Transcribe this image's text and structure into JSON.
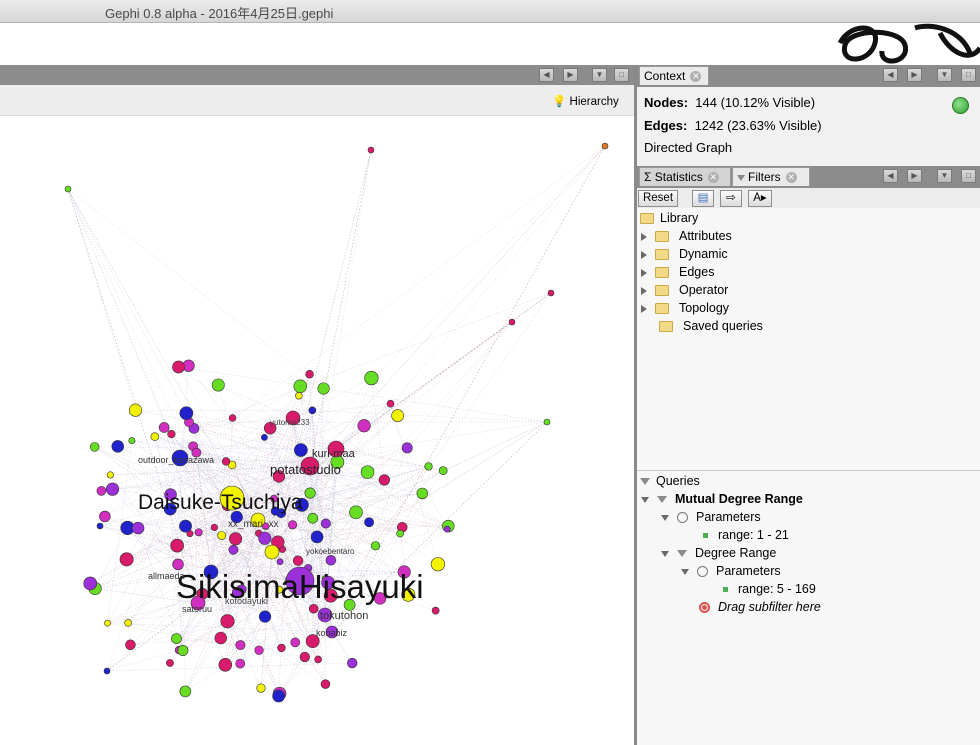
{
  "window": {
    "title": "Gephi 0.8 alpha  - 2016年4月25日.gephi"
  },
  "graph": {
    "toolbar": {
      "hierarchy_label": "Hierarchy"
    },
    "labels": [
      {
        "text": "SikisimaHisayuki",
        "size": "big"
      },
      {
        "text": "Daisuke-Tsuchiya",
        "size": "medium"
      },
      {
        "text": "potatostudio",
        "size": "small"
      },
      {
        "text": "kuri-maa",
        "size": "small"
      },
      {
        "text": "outdoor_kanazawa",
        "size": "tiny"
      },
      {
        "text": "xx_mari_xx",
        "size": "tiny"
      },
      {
        "text": "yokoebentaro",
        "size": "tiny"
      },
      {
        "text": "allmaeda",
        "size": "tiny"
      },
      {
        "text": "satoruu",
        "size": "tiny"
      },
      {
        "text": "tokutohon",
        "size": "tiny"
      },
      {
        "text": "kobabiz",
        "size": "tiny"
      },
      {
        "text": "yutoma233",
        "size": "tiny"
      },
      {
        "text": "kotodayuki",
        "size": "tiny"
      }
    ]
  },
  "context": {
    "tab_label": "Context",
    "nodes_label": "Nodes:",
    "nodes_value": "144 (10.12% Visible)",
    "edges_label": "Edges:",
    "edges_value": "1242 (23.63% Visible)",
    "graph_type": "Directed Graph"
  },
  "filters_panel": {
    "tabs": [
      {
        "label": "Statistics",
        "icon": "sigma-icon"
      },
      {
        "label": "Filters",
        "icon": "filter-icon"
      }
    ],
    "reset_label": "Reset",
    "library_label": "Library",
    "library_items": [
      "Attributes",
      "Dynamic",
      "Edges",
      "Operator",
      "Topology"
    ],
    "saved_queries_label": "Saved queries",
    "queries": {
      "label": "Queries",
      "root": "Mutual Degree Range",
      "root_params_label": "Parameters",
      "root_range": "range: 1 - 21",
      "sub": "Degree Range",
      "sub_params_label": "Parameters",
      "sub_range": "range: 5 - 169",
      "drag_hint": "Drag subfilter here"
    }
  },
  "colors": {
    "pink": "#d81b6b",
    "magenta": "#d12fbf",
    "purple": "#9b30d9",
    "blue": "#2222cc",
    "yellow": "#f2f200",
    "green": "#66dd22",
    "panel_dark": "#8c8c8c"
  }
}
